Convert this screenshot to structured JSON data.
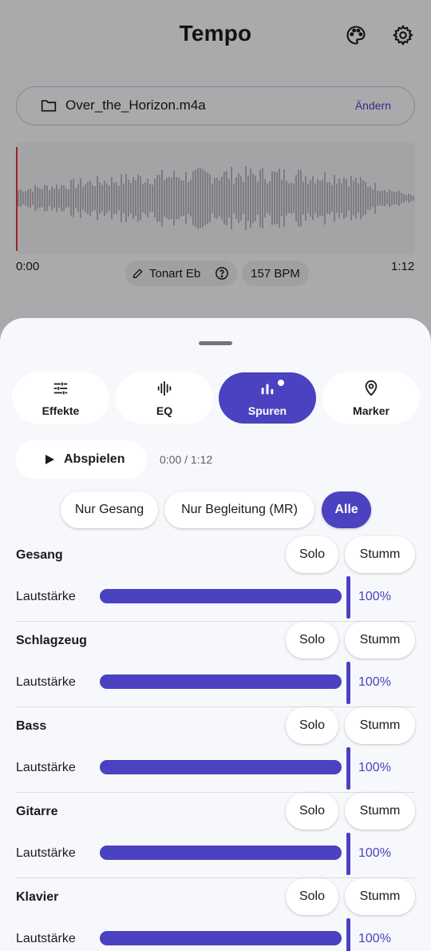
{
  "app": {
    "title": "Tempo",
    "file_name": "Over_the_Horizon.m4a",
    "change_label": "Ändern",
    "time_start": "0:00",
    "time_end": "1:12",
    "key_label": "Tonart Eb",
    "bpm_label": "157 BPM",
    "icons": {
      "palette": "palette-icon",
      "settings": "gear-icon",
      "folder": "folder-icon",
      "edit": "pencil-icon",
      "help": "help-circle-icon"
    }
  },
  "sheet": {
    "tabs": [
      {
        "label": "Effekte",
        "icon": "sliders-icon",
        "active": false
      },
      {
        "label": "EQ",
        "icon": "waveform-icon",
        "active": false
      },
      {
        "label": "Spuren",
        "icon": "bar-chart-icon",
        "active": true
      },
      {
        "label": "Marker",
        "icon": "map-pin-icon",
        "active": false
      }
    ],
    "play": {
      "label": "Abspielen",
      "time": "0:00 / 1:12"
    },
    "filters": [
      {
        "label": "Nur Gesang",
        "active": false
      },
      {
        "label": "Nur Begleitung (MR)",
        "active": false
      },
      {
        "label": "Alle",
        "active": true
      }
    ],
    "tracks": [
      {
        "name": "Gesang",
        "solo": "Solo",
        "mute": "Stumm",
        "volume_label": "Lautstärke",
        "volume": "100%"
      },
      {
        "name": "Schlagzeug",
        "solo": "Solo",
        "mute": "Stumm",
        "volume_label": "Lautstärke",
        "volume": "100%"
      },
      {
        "name": "Bass",
        "solo": "Solo",
        "mute": "Stumm",
        "volume_label": "Lautstärke",
        "volume": "100%"
      },
      {
        "name": "Gitarre",
        "solo": "Solo",
        "mute": "Stumm",
        "volume_label": "Lautstärke",
        "volume": "100%"
      },
      {
        "name": "Klavier",
        "solo": "Solo",
        "mute": "Stumm",
        "volume_label": "Lautstärke",
        "volume": "100%"
      }
    ]
  },
  "colors": {
    "accent": "#4a42c0",
    "sheet_bg": "#f7f8fb",
    "playhead": "#e53935"
  }
}
